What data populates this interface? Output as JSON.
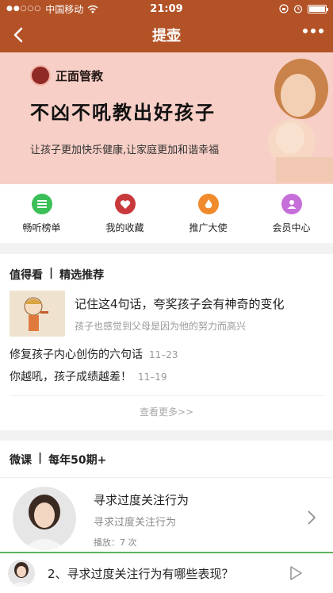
{
  "status": {
    "carrier": "中国移动",
    "time": "21:09"
  },
  "nav": {
    "title": "提壶"
  },
  "banner": {
    "brand": "正面管教",
    "headline": "不凶不吼教出好孩子",
    "tagline": "让孩子更加快乐健康,让家庭更加和谐幸福"
  },
  "icons": [
    {
      "label": "畅听榜单",
      "icon": "list-icon",
      "color": "#3bbf57"
    },
    {
      "label": "我的收藏",
      "icon": "heart-icon",
      "color": "#c8393c"
    },
    {
      "label": "推广大使",
      "icon": "flame-icon",
      "color": "#f08a2c"
    },
    {
      "label": "会员中心",
      "icon": "user-icon",
      "color": "#c66fd8"
    }
  ],
  "section1": {
    "title": "值得看",
    "subtitle": "精选推荐",
    "featured": {
      "title": "记住这4句话，夸奖孩子会有神奇的变化",
      "subtitle": "孩子也感觉到父母是因为他的努力而高兴"
    },
    "items": [
      {
        "title": "修复孩子内心创伤的六句话",
        "date": "11–23"
      },
      {
        "title": "你越吼，孩子成绩越差！",
        "date": "11–19"
      }
    ],
    "more": "查看更多>>"
  },
  "section2": {
    "title": "微课",
    "subtitle": "每年50期+",
    "course": {
      "title": "寻求过度关注行为",
      "subtitle": "寻求过度关注行为",
      "plays": "播放：7 次"
    }
  },
  "player": {
    "title": "2、寻求过度关注行为有哪些表现？"
  }
}
